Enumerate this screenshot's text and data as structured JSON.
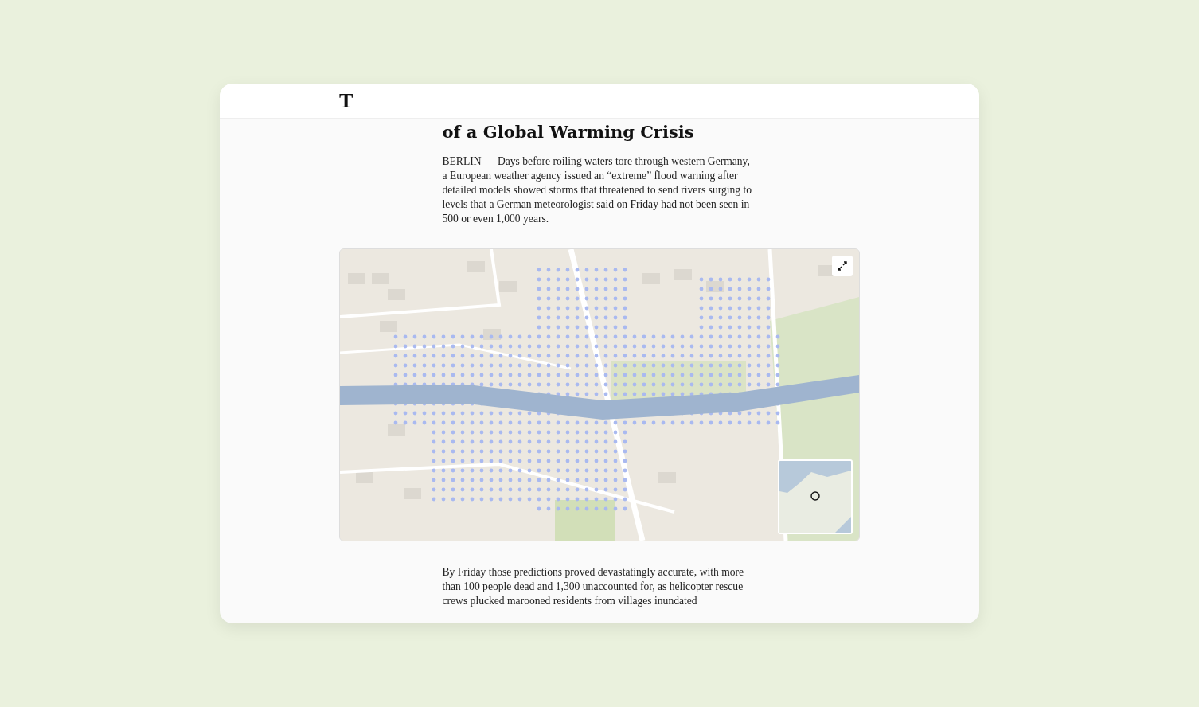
{
  "header": {
    "logo": "T"
  },
  "article": {
    "headline": "of a Global Warming Crisis",
    "paragraphs": [
      "BERLIN — Days before roiling waters tore through western Germany, a European weather agency issued an “extreme” flood warning after detailed models showed storms that threatened to send rivers surging to levels that a German meteorologist said on Friday had not been seen in 500 or even 1,000 years.",
      "By Friday those predictions proved devastatingly accurate, with more than 100 people dead and 1,300 unaccounted for, as helicopter rescue crews plucked marooned residents from villages inundated"
    ]
  }
}
